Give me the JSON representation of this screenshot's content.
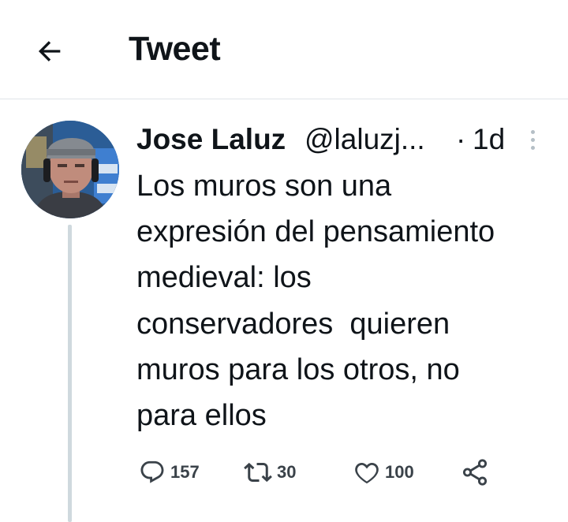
{
  "header": {
    "title": "Tweet",
    "back_icon": "arrow-left-icon"
  },
  "tweet": {
    "display_name": "Jose Laluz",
    "handle": "@laluzj...",
    "separator": "·",
    "time": "1d",
    "text": "Los muros son una\nexpresión del pensamiento\nmedieval: los\nconservadores  quieren\nmuros para los otros, no\npara ellos",
    "avatar_icon": "user-avatar"
  },
  "actions": {
    "reply": {
      "icon": "reply-icon",
      "count": "157"
    },
    "retweet": {
      "icon": "retweet-icon",
      "count": "30"
    },
    "like": {
      "icon": "heart-icon",
      "count": "100"
    },
    "share": {
      "icon": "share-icon"
    }
  },
  "colors": {
    "text": "#0f1419",
    "divider": "#dfe4e8",
    "thread_line": "#cfd9de",
    "icon_gray": "#3a4249"
  }
}
